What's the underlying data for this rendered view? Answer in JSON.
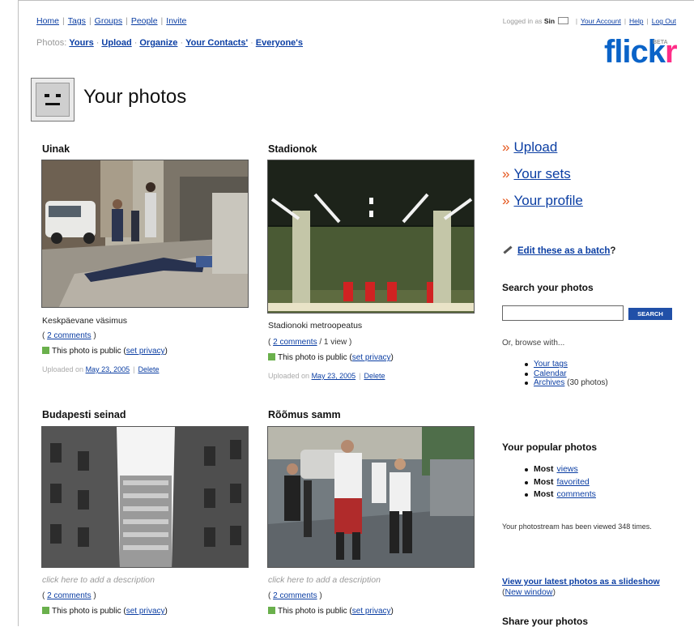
{
  "topnav": {
    "items": [
      "Home",
      "Tags",
      "Groups",
      "People",
      "Invite"
    ]
  },
  "account": {
    "logged_in_as": "Logged in as",
    "username": "Sin",
    "your_account": "Your Account",
    "help": "Help",
    "logout": "Log Out"
  },
  "subnav": {
    "label": "Photos:",
    "items": [
      "Yours",
      "Upload",
      "Organize",
      "Your Contacts'",
      "Everyone's"
    ]
  },
  "logo": {
    "text1": "flick",
    "text2": "r",
    "beta": "BETA",
    "colors": {
      "blue": "#0a63c8",
      "pink": "#ff2d88"
    }
  },
  "page": {
    "title": "Your photos"
  },
  "photos": [
    {
      "title": "Uinak",
      "description": "Keskpäevane väsimus",
      "comments": "2 comments",
      "views": "",
      "privacy": "This photo is public",
      "set_privacy": "set privacy",
      "uploaded": "Uploaded on",
      "date": "May 23, 2005",
      "delete": "Delete"
    },
    {
      "title": "Stadionok",
      "description": "Stadionoki metroopeatus",
      "comments": "2 comments",
      "views": "/ 1 view",
      "privacy": "This photo is public",
      "set_privacy": "set privacy",
      "uploaded": "Uploaded on",
      "date": "May 23, 2005",
      "delete": "Delete"
    },
    {
      "title": "Budapesti seinad",
      "description": "click here to add a description",
      "comments": "2 comments",
      "privacy": "This photo is public",
      "set_privacy": "set privacy"
    },
    {
      "title": "Rõõmus samm",
      "description": "click here to add a description",
      "comments": "2 comments",
      "privacy": "This photo is public",
      "set_privacy": "set privacy"
    }
  ],
  "sidebar": {
    "links": [
      "Upload",
      "Your sets",
      "Your profile"
    ],
    "batch_text": "Edit these as a batch",
    "batch_q": "?",
    "search_heading": "Search your photos",
    "search_button": "SEARCH",
    "browse_label": "Or, browse with...",
    "browse": [
      {
        "link": "Your tags",
        "extra": ""
      },
      {
        "link": "Calendar",
        "extra": ""
      },
      {
        "link": "Archives",
        "extra": "(30 photos)"
      }
    ],
    "popular_heading": "Your popular photos",
    "popular": [
      {
        "most": "Most",
        "link": "views"
      },
      {
        "most": "Most",
        "link": "favorited"
      },
      {
        "most": "Most",
        "link": "comments"
      }
    ],
    "viewed_text": "Your photostream has been viewed 348 times.",
    "slideshow": "View your latest photos as a slideshow",
    "new_window": "New window",
    "share": "Share your photos"
  }
}
